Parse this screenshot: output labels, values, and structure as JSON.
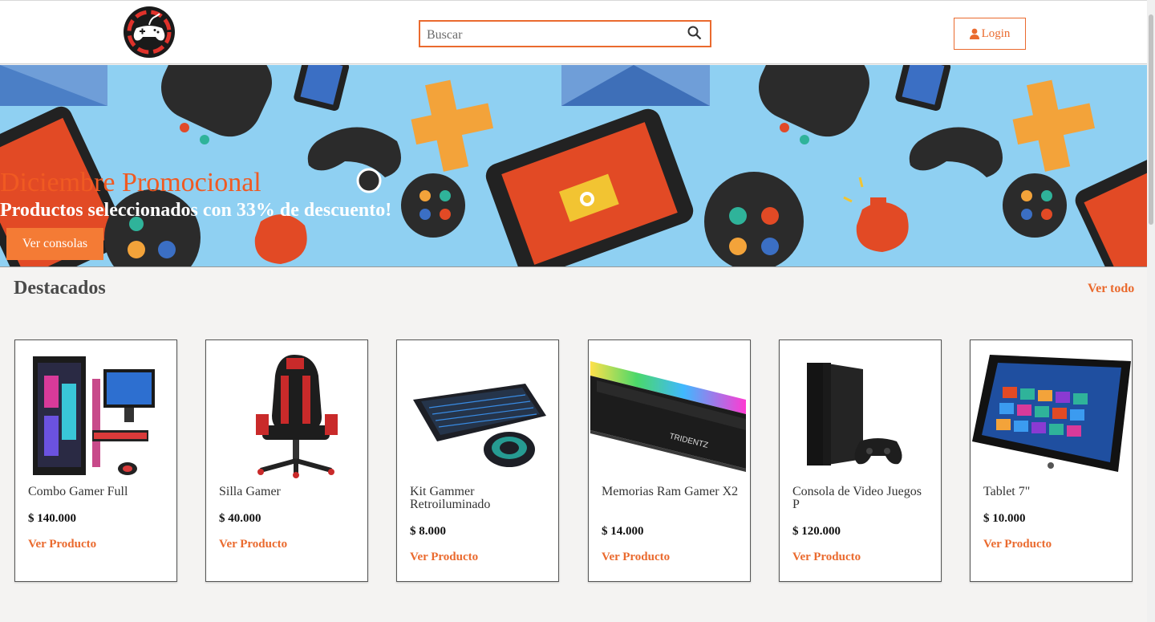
{
  "header": {
    "search": {
      "placeholder": "Buscar"
    },
    "login_label": "Login"
  },
  "banner": {
    "title": "Diciembre Promocional",
    "subtitle": "Productos seleccionados con 33% de descuento!",
    "button_label": "Ver consolas"
  },
  "featured": {
    "title": "Destacados",
    "see_all": "Ver todo",
    "link_label": "Ver Producto",
    "products": [
      {
        "name": "Combo Gamer Full",
        "price": "$ 140.000"
      },
      {
        "name": "Silla Gamer",
        "price": "$ 40.000"
      },
      {
        "name": "Kit Gammer Retroiluminado",
        "price": "$ 8.000"
      },
      {
        "name": "Memorias Ram Gamer X2",
        "price": "$ 14.000"
      },
      {
        "name": "Consola de Video Juegos P",
        "price": "$ 120.000"
      },
      {
        "name": "Tablet 7\"",
        "price": "$ 10.000"
      }
    ]
  },
  "colors": {
    "accent": "#ea6a2e",
    "banner_bg": "#8fd0f2",
    "page_bg": "#f4f3f2"
  }
}
